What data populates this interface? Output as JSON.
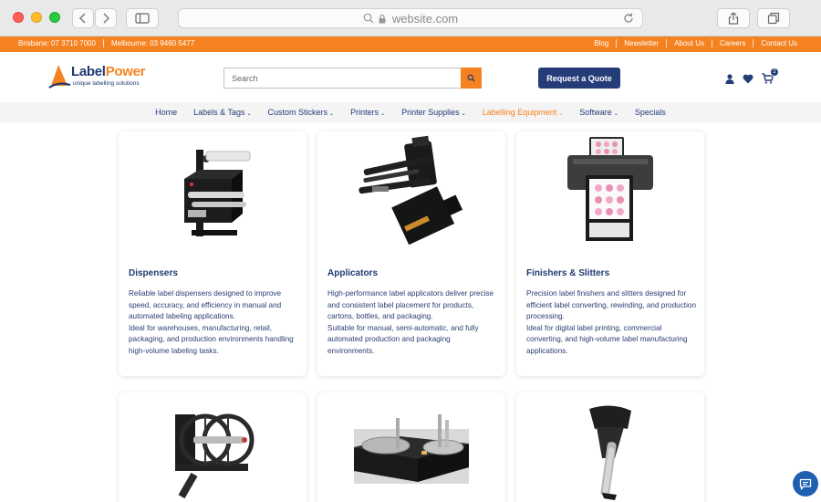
{
  "browser": {
    "url": "website.com"
  },
  "topbar": {
    "phones": [
      "Brisbane: 07 3710 7000",
      "Melbourne: 03 9460 5477"
    ],
    "links": [
      "Blog",
      "Newsletter",
      "About Us",
      "Careers",
      "Contact Us"
    ]
  },
  "header": {
    "logo_main": "Label",
    "logo_accent": "Power",
    "logo_tagline": "unique labelling solutions",
    "search_placeholder": "Search",
    "quote_label": "Request a Quote",
    "cart_count": "2"
  },
  "nav": [
    {
      "label": "Home",
      "dropdown": false
    },
    {
      "label": "Labels & Tags",
      "dropdown": true
    },
    {
      "label": "Custom Stickers",
      "dropdown": true
    },
    {
      "label": "Printers",
      "dropdown": true
    },
    {
      "label": "Printer Supplies",
      "dropdown": true
    },
    {
      "label": "Labelling Equipment",
      "dropdown": true,
      "active": true
    },
    {
      "label": "Software",
      "dropdown": true
    },
    {
      "label": "Specials",
      "dropdown": false
    }
  ],
  "cards": [
    {
      "title": "Dispensers",
      "description": "Reliable label dispensers designed to improve speed, accuracy, and efficiency in manual and automated labeling applications.\nIdeal for warehouses, manufacturing, retail, packaging, and production environments handling high-volume labeling tasks."
    },
    {
      "title": "Applicators",
      "description": "High-performance label applicators deliver precise and consistent label placement for products, cartons, bottles, and packaging.\nSuitable for manual, semi-automatic, and fully automated production and packaging environments."
    },
    {
      "title": "Finishers & Slitters",
      "description": "Precision label finishers and slitters designed for efficient label converting, rewinding, and production processing.\nIdeal for digital label printing, commercial converting, and high-volume label manufacturing applications."
    }
  ],
  "colors": {
    "accent": "#f58220",
    "brand": "#243c78"
  }
}
